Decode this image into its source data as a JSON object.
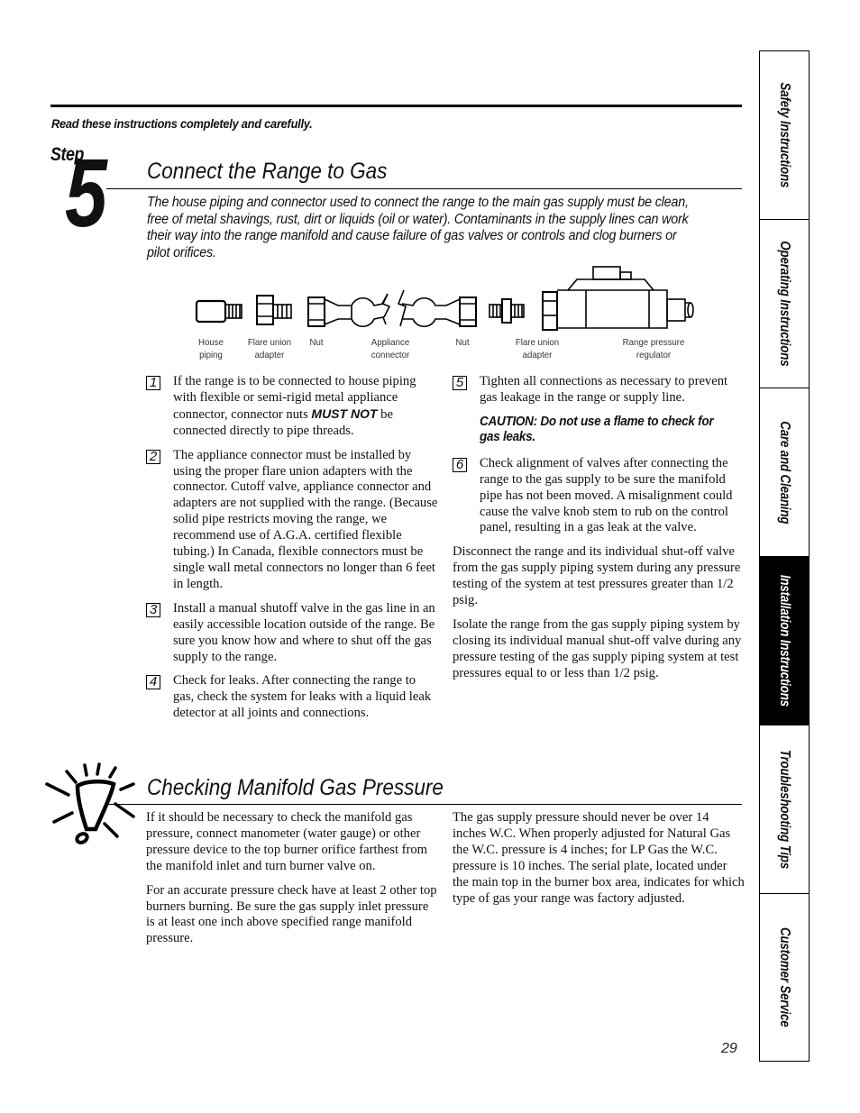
{
  "header": {
    "read_note": "Read these instructions completely and carefully."
  },
  "step": {
    "word": "Step",
    "number": "5"
  },
  "connect_section": {
    "title": "Connect the Range to Gas",
    "intro": "The house piping and connector used to connect the range to the main gas supply must be clean, free of metal shavings, rust, dirt or liquids (oil or water). Contaminants in the supply lines can work their way into the range manifold and cause failure of gas valves or controls and clog burners or pilot orifices."
  },
  "diagram": {
    "parts": [
      {
        "icon": "house-piping-icon",
        "label_line1": "House",
        "label_line2": "piping"
      },
      {
        "icon": "flare-union-adapter-icon",
        "label_line1": "Flare union",
        "label_line2": "adapter"
      },
      {
        "icon": "nut-icon",
        "label_line1": "Nut",
        "label_line2": ""
      },
      {
        "icon": "appliance-connector-icon",
        "label_line1": "Appliance",
        "label_line2": "connector"
      },
      {
        "icon": "nut-icon",
        "label_line1": "Nut",
        "label_line2": ""
      },
      {
        "icon": "flare-union-adapter-icon",
        "label_line1": "Flare union",
        "label_line2": "adapter"
      },
      {
        "icon": "range-pressure-regulator-icon",
        "label_line1": "Range pressure",
        "label_line2": "regulator"
      }
    ]
  },
  "steps_left": [
    {
      "number": "1",
      "text_before": "If the range is to be connected to house piping with flexible or semi-rigid metal appliance connector, connector nuts ",
      "emphasis": "MUST NOT",
      "text_after": " be connected directly to pipe threads."
    },
    {
      "number": "2",
      "text": "The appliance connector must be installed by using the proper flare union adapters with the connector. Cutoff valve, appliance connector and adapters are not supplied with the range. (Because solid pipe restricts moving the range, we recommend use of A.G.A. certified flexible tubing.) In Canada, flexible connectors must be single wall metal connectors no longer than 6 feet in length."
    },
    {
      "number": "3",
      "text": "Install a manual shutoff valve in the gas line in an easily accessible location outside of the range. Be sure you know how and where to shut off the gas supply to the range."
    },
    {
      "number": "4",
      "text": "Check for leaks. After connecting the range to gas, check the system for leaks with a liquid leak detector at all joints and connections."
    }
  ],
  "steps_right": [
    {
      "number": "5",
      "text": "Tighten all connections as necessary to prevent gas leakage in the range or supply line."
    },
    {
      "number": "6",
      "text": "Check alignment of valves after connecting the range to the gas supply to be sure the manifold pipe has not been moved. A misalignment could cause the valve knob stem to rub on the control panel, resulting in a gas leak at the valve."
    }
  ],
  "caution": "CAUTION: Do not use a flame to check for gas leaks.",
  "right_paragraphs": [
    "Disconnect the range and its individual shut-off valve from the gas supply piping system during any pressure testing of the system at test pressures greater than 1/2 psig.",
    "Isolate the range from the gas supply piping system by closing its individual manual shut-off valve during any pressure testing of the gas supply piping system at test pressures equal to or less than 1/2 psig."
  ],
  "manifold_section": {
    "icon": "exclamation-tip-icon",
    "title": "Checking Manifold Gas Pressure",
    "left_paragraphs": [
      "If it should be necessary to check the manifold gas pressure, connect manometer (water gauge) or other pressure device to the top burner orifice farthest from the manifold inlet and turn burner valve on.",
      "For an accurate pressure check have at least 2 other top burners burning. Be sure the gas supply inlet pressure is at least one inch above specified range manifold pressure."
    ],
    "right_paragraphs": [
      "The gas supply pressure should never be over 14 inches W.C. When properly adjusted for Natural Gas the W.C. pressure is 4 inches; for LP Gas the W.C. pressure is 10 inches. The serial plate, located under the main top in the burner box area, indicates for which type of gas your range was factory adjusted."
    ]
  },
  "page_number": "29",
  "side_tabs": [
    {
      "label": "Safety Instructions",
      "active": false
    },
    {
      "label": "Operating Instructions",
      "active": false
    },
    {
      "label": "Care and Cleaning",
      "active": false
    },
    {
      "label": "Installation Instructions",
      "active": true
    },
    {
      "label": "Troubleshooting Tips",
      "active": false
    },
    {
      "label": "Customer Service",
      "active": false
    }
  ]
}
